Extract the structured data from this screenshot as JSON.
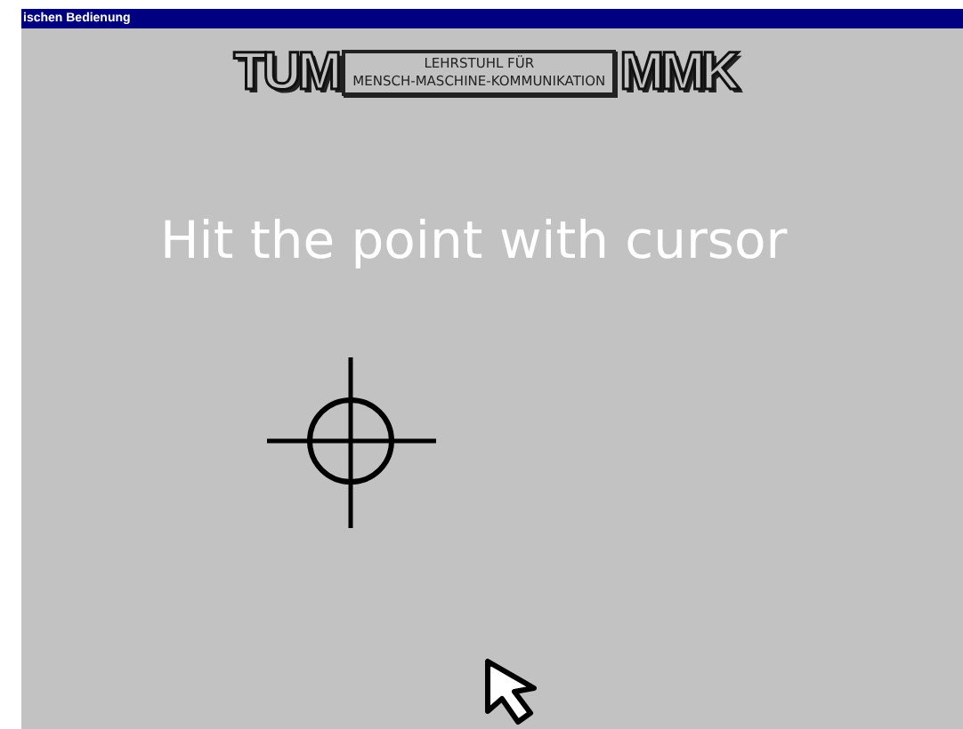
{
  "window": {
    "title": "ischen Bedienung"
  },
  "logo": {
    "left_mark": "TUM",
    "line_1": "LEHRSTUHL FÜR",
    "line_2": "MENSCH-MASCHINE-KOMMUNIKATION",
    "right_mark": "MMK"
  },
  "instruction": "Hit the point with cursor"
}
